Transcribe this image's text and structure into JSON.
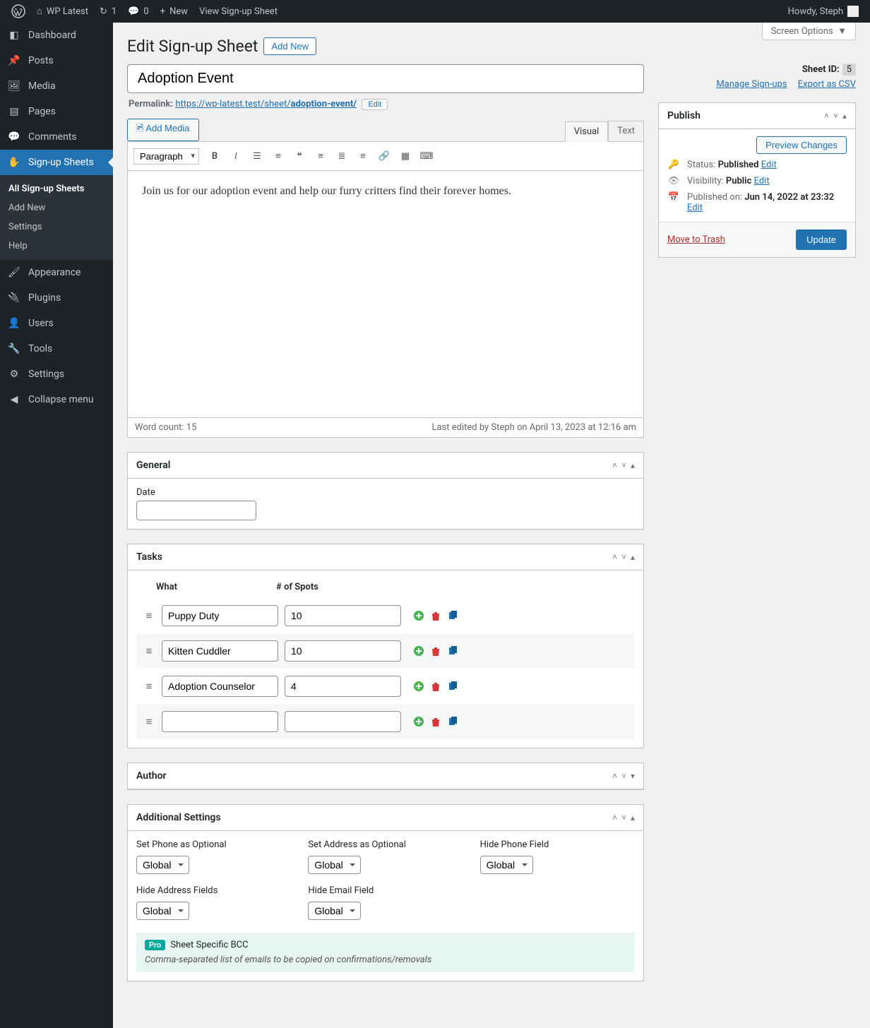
{
  "adminbar": {
    "site": "WP Latest",
    "updates": "1",
    "comments": "0",
    "new": "New",
    "view": "View Sign-up Sheet",
    "howdy": "Howdy, Steph"
  },
  "sidebar": {
    "dashboard": "Dashboard",
    "posts": "Posts",
    "media": "Media",
    "pages": "Pages",
    "comments": "Comments",
    "signup": "Sign-up Sheets",
    "sub_all": "All Sign-up Sheets",
    "sub_add": "Add New",
    "sub_settings": "Settings",
    "sub_help": "Help",
    "appearance": "Appearance",
    "plugins": "Plugins",
    "users": "Users",
    "tools": "Tools",
    "settings": "Settings",
    "collapse": "Collapse menu"
  },
  "screen_options": "Screen Options",
  "page": {
    "heading": "Edit Sign-up Sheet",
    "add_new": "Add New",
    "title": "Adoption Event",
    "permalink_label": "Permalink:",
    "permalink_base": "https://wp-latest.test/sheet/",
    "permalink_slug": "adoption-event/",
    "permalink_edit": "Edit"
  },
  "editor": {
    "add_media": "Add Media",
    "tab_visual": "Visual",
    "tab_text": "Text",
    "format": "Paragraph",
    "content": "Join us for our adoption event and help our furry critters find their forever homes.",
    "word_count": "Word count: 15",
    "last_edited": "Last edited by Steph on April 13, 2023 at 12:16 am"
  },
  "sheet_meta": {
    "label": "Sheet ID:",
    "id": "5",
    "manage": "Manage Sign-ups",
    "export": "Export as CSV"
  },
  "publish": {
    "title": "Publish",
    "preview": "Preview Changes",
    "status_label": "Status:",
    "status": "Published",
    "visibility_label": "Visibility:",
    "visibility": "Public",
    "published_label": "Published on:",
    "published_date": "Jun 14, 2022 at 23:32",
    "edit": "Edit",
    "trash": "Move to Trash",
    "update": "Update"
  },
  "general": {
    "title": "General",
    "date_label": "Date"
  },
  "tasks": {
    "title": "Tasks",
    "head_what": "What",
    "head_spots": "# of Spots",
    "rows": [
      {
        "what": "Puppy Duty",
        "spots": "10"
      },
      {
        "what": "Kitten Cuddler",
        "spots": "10"
      },
      {
        "what": "Adoption Counselor",
        "spots": "4"
      },
      {
        "what": "",
        "spots": ""
      }
    ]
  },
  "author": {
    "title": "Author"
  },
  "additional": {
    "title": "Additional Settings",
    "opt_global": "Global",
    "f_phone_opt": "Set Phone as Optional",
    "f_address_opt": "Set Address as Optional",
    "f_hide_phone": "Hide Phone Field",
    "f_hide_address": "Hide Address Fields",
    "f_hide_email": "Hide Email Field",
    "pro_label": "Pro",
    "bcc_label": "Sheet Specific BCC",
    "bcc_hint": "Comma-separated list of emails to be copied on confirmations/removals"
  }
}
